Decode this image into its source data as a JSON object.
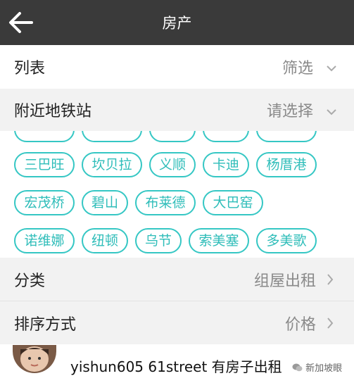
{
  "header": {
    "title": "房产"
  },
  "filters": {
    "list": {
      "label": "列表",
      "value": "筛选"
    },
    "metro": {
      "label": "附近地铁站",
      "value": "请选择"
    },
    "category": {
      "label": "分类",
      "value": "组屋出租"
    },
    "sort": {
      "label": "排序方式",
      "value": "价格"
    }
  },
  "stations": {
    "row_partial": [
      "",
      "",
      "",
      "",
      ""
    ],
    "row1": [
      "三巴旺",
      "坎贝拉",
      "义顺",
      "卡迪",
      "杨厝港"
    ],
    "row2": [
      "宏茂桥",
      "碧山",
      "布莱德",
      "大巴窑"
    ],
    "row3": [
      "诺维娜",
      "纽顿",
      "乌节",
      "索美塞",
      "多美歌"
    ]
  },
  "footer": {
    "post_title": "yishun605 61street 有房子出租",
    "watermark": "新加坡眼"
  },
  "colors": {
    "topbar": "#3a3a3a",
    "accent": "#35c7c4",
    "row_bg": "#f2f2f2"
  }
}
